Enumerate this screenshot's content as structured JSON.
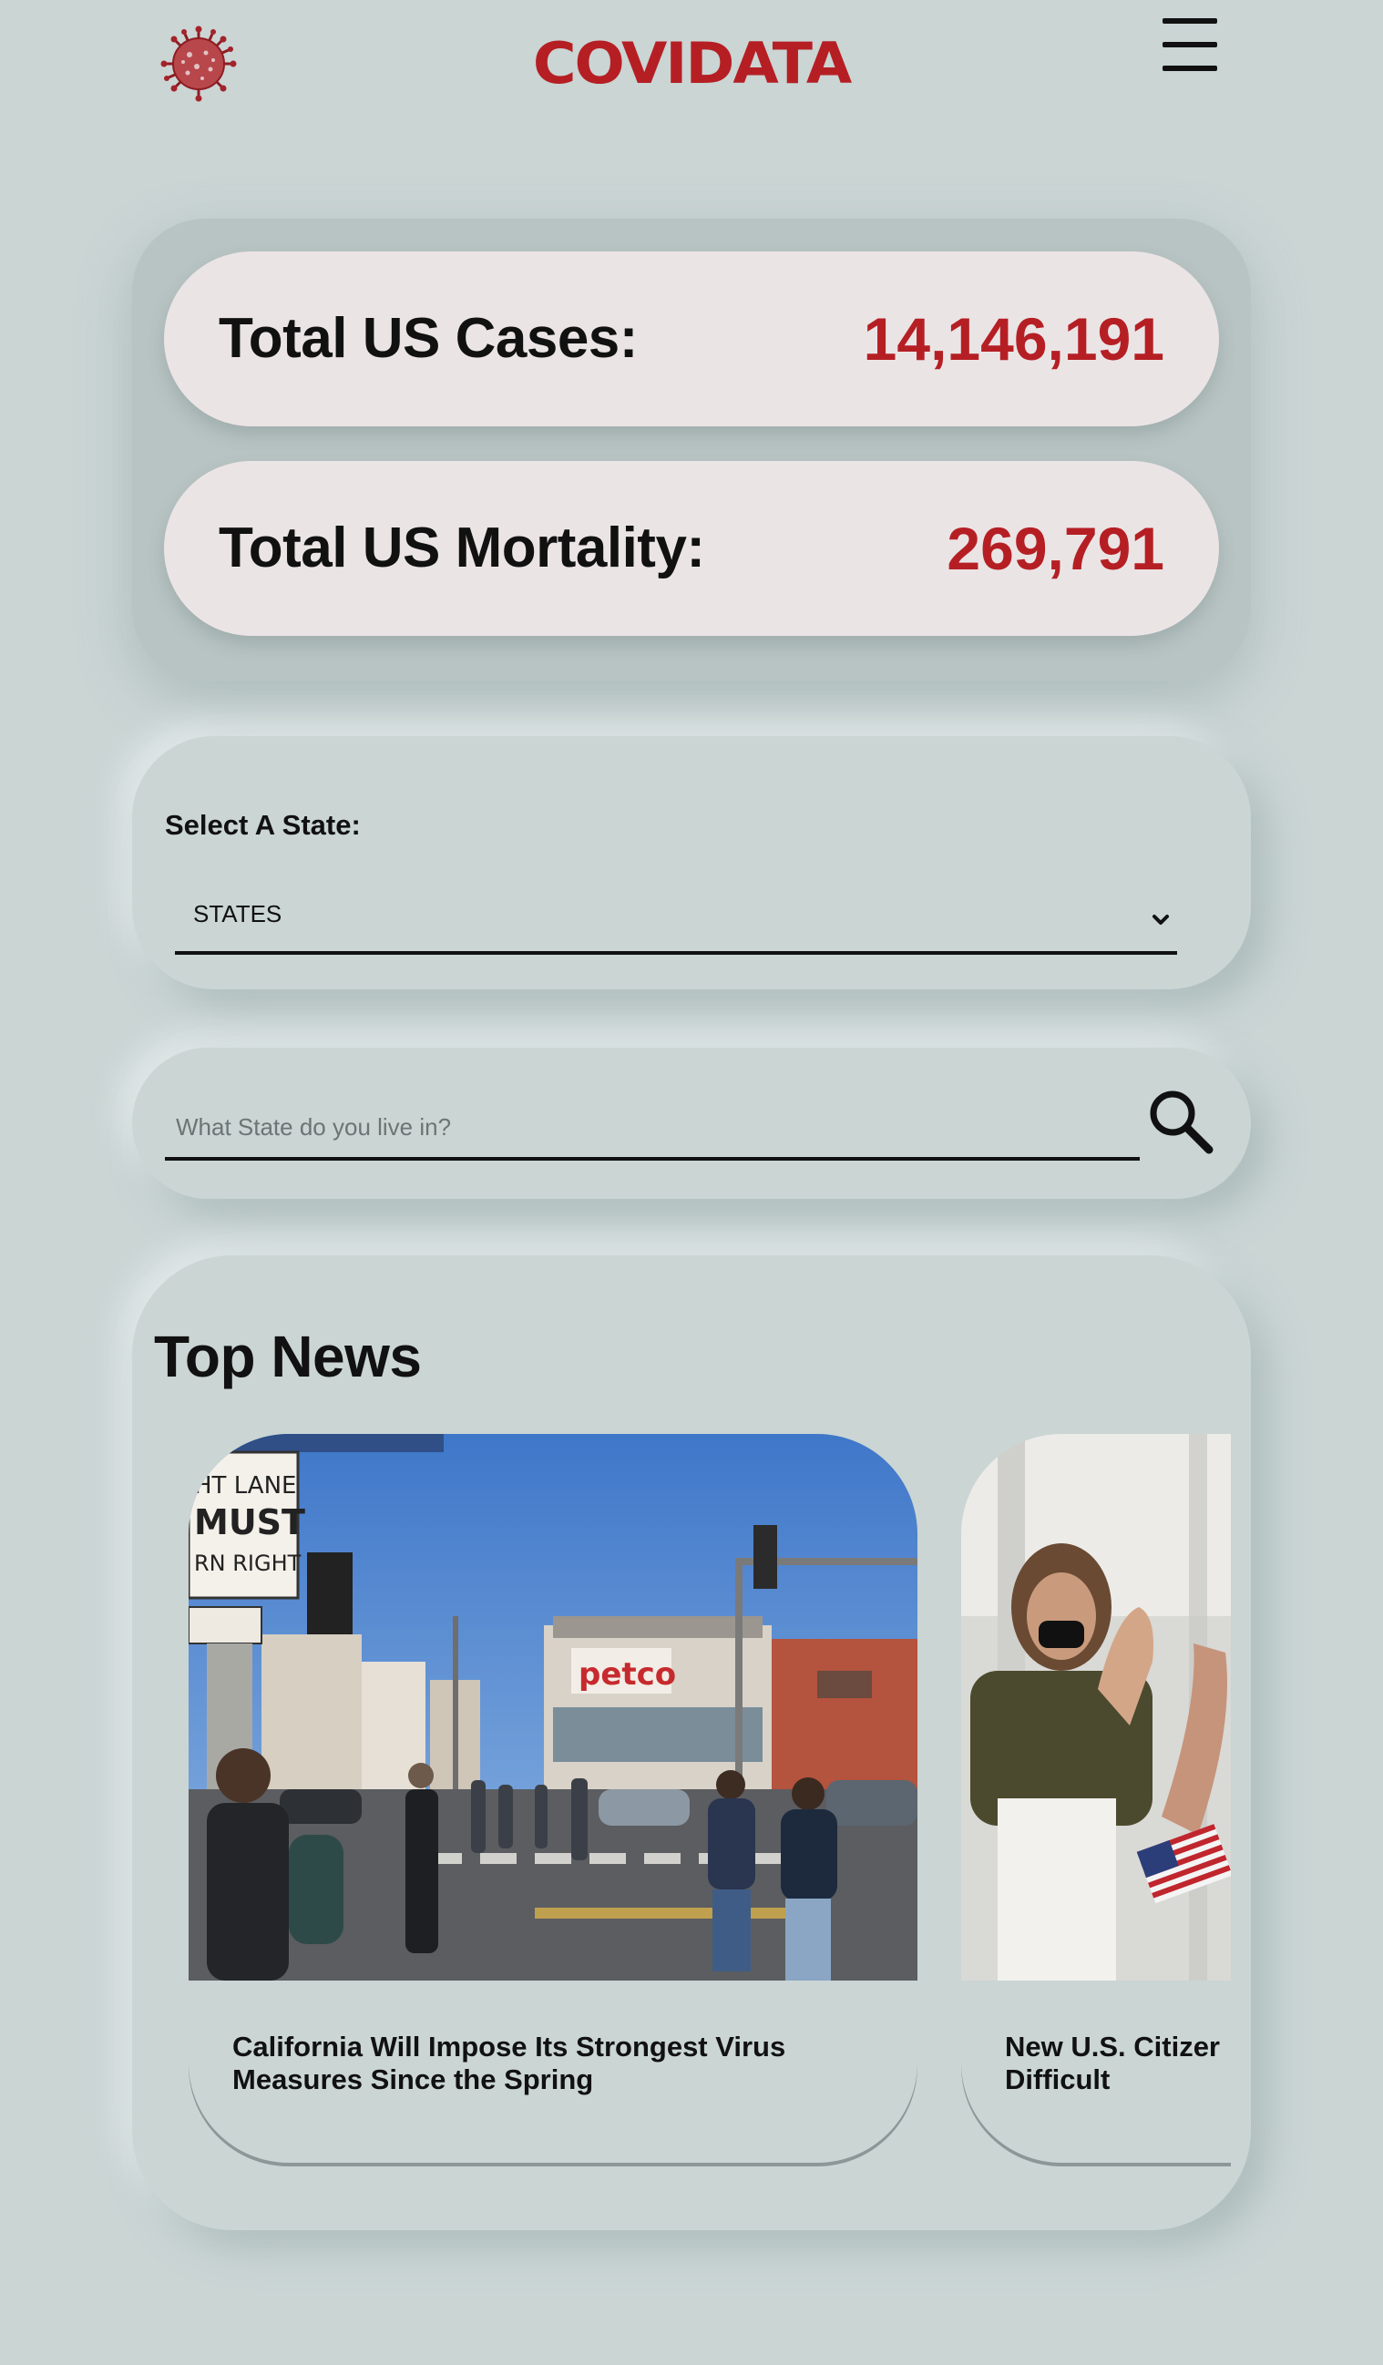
{
  "header": {
    "brand": "COVIDATA",
    "logo_icon": "virus-icon",
    "menu_icon": "hamburger-menu-icon",
    "brand_color": "#b51f24"
  },
  "stats": {
    "cases_label": "Total US Cases:",
    "cases_value": "14,146,191",
    "mortality_label": "Total US Mortality:",
    "mortality_value": "269,791",
    "value_color": "#b51f24"
  },
  "state_select": {
    "label": "Select A State:",
    "selected": "STATES",
    "icon": "chevron-down-icon"
  },
  "search": {
    "placeholder": "What State do you live in?",
    "icon": "search-icon"
  },
  "news": {
    "title": "Top News",
    "items": [
      {
        "headline": "California Will Impose Its Strongest Virus\nMeasures Since the Spring",
        "image": "street-crosswalk-photo"
      },
      {
        "headline": "New U.S. Citizer\nDifficult",
        "image": "citizenship-oath-photo"
      }
    ]
  },
  "colors": {
    "background": "#cad5d4",
    "stats_pill": "#ebe4e5"
  }
}
